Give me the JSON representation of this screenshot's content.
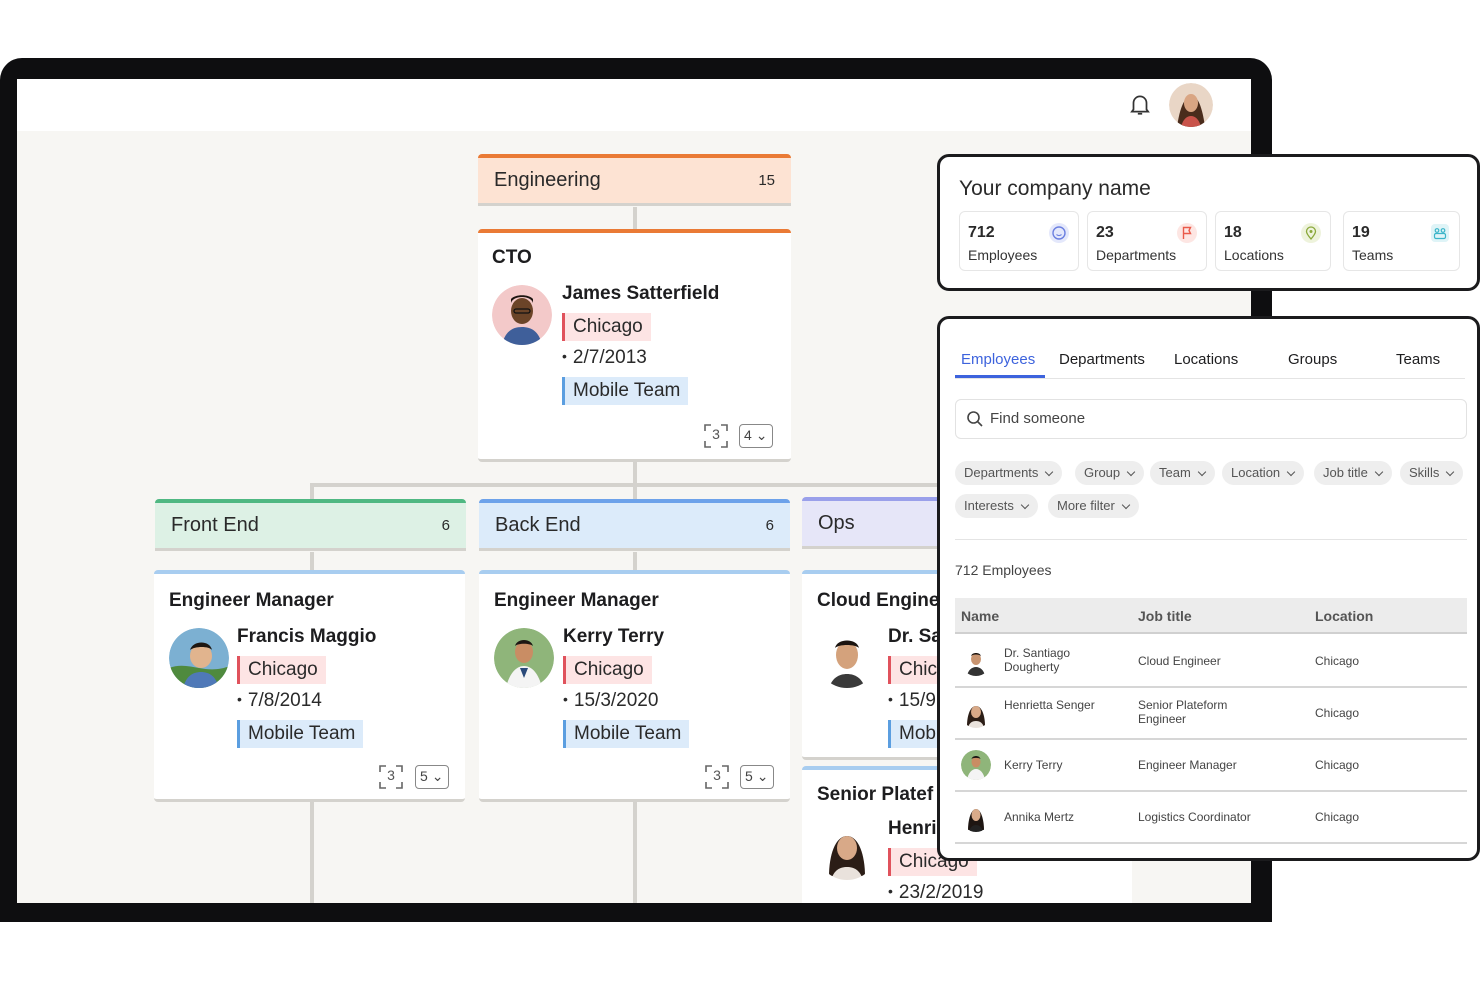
{
  "org_chart": {
    "root": {
      "name": "Engineering",
      "count": "15",
      "color": "#ea7a35",
      "bg": "#fde3d3"
    },
    "cto": {
      "title": "CTO",
      "name": "James Satterfield",
      "location": "Chicago",
      "date": "2/7/2013",
      "team": "Mobile Team",
      "frame_count": "3",
      "reports": "4"
    },
    "departments": [
      {
        "name": "Front End",
        "count": "6",
        "color": "#4fb882",
        "bg": "#ddf1e5"
      },
      {
        "name": "Back End",
        "count": "6",
        "color": "#6da2ea",
        "bg": "#dcebfa"
      },
      {
        "name": "Ops",
        "count": "",
        "color": "#9aa0ea",
        "bg": "#e6e6f8"
      }
    ],
    "managers": [
      {
        "title": "Engineer Manager",
        "name": "Francis Maggio",
        "location": "Chicago",
        "date": "7/8/2014",
        "team": "Mobile Team",
        "frame_count": "3",
        "reports": "5"
      },
      {
        "title": "Engineer Manager",
        "name": "Kerry Terry",
        "location": "Chicago",
        "date": "15/3/2020",
        "team": "Mobile Team",
        "frame_count": "3",
        "reports": "5"
      },
      {
        "title": "Cloud Engine",
        "name": "Dr. Sa",
        "location": "Chica",
        "date": "15/9",
        "team": "Mob"
      }
    ],
    "lower_card": {
      "title": "Senior Platef",
      "name": "Henri",
      "location": "Chicago",
      "date": "23/2/2019"
    }
  },
  "company": {
    "name": "Your company name",
    "stats": [
      {
        "value": "712",
        "label": "Employees",
        "icon": "smile-icon",
        "color": "#6b7fe0"
      },
      {
        "value": "23",
        "label": "Departments",
        "icon": "flag-icon",
        "color": "#ea5a4a"
      },
      {
        "value": "18",
        "label": "Locations",
        "icon": "map-pin-icon",
        "color": "#8aa83a"
      },
      {
        "value": "19",
        "label": "Teams",
        "icon": "team-icon",
        "color": "#3bb5c9"
      }
    ]
  },
  "directory": {
    "tabs": [
      "Employees",
      "Departments",
      "Locations",
      "Groups",
      "Teams"
    ],
    "active_tab": "Employees",
    "search_placeholder": "Find someone",
    "filters": [
      "Departments",
      "Group",
      "Team",
      "Location",
      "Job title",
      "Skills",
      "Interests",
      "More filter"
    ],
    "employee_count": "712 Employees",
    "columns": [
      "Name",
      "Job title",
      "Location"
    ],
    "rows": [
      {
        "name": "Dr. Santiago Dougherty",
        "job": "Cloud Engineer",
        "location": "Chicago"
      },
      {
        "name": "Henrietta Senger",
        "job": "Senior Plateform Engineer",
        "location": "Chicago"
      },
      {
        "name": "Kerry Terry",
        "job": "Engineer Manager",
        "location": "Chicago"
      },
      {
        "name": "Annika Mertz",
        "job": "Logistics Coordinator",
        "location": "Chicago"
      }
    ]
  },
  "accent_color": "#3d63dd"
}
